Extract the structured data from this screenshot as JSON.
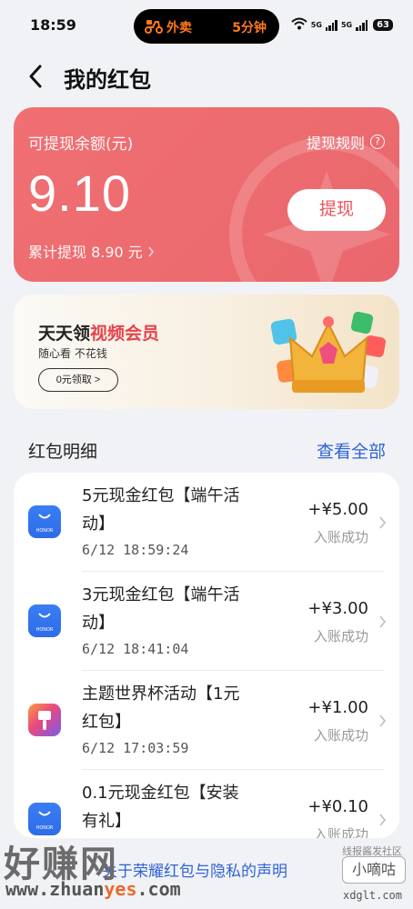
{
  "status_bar": {
    "time": "18:59",
    "island_text": "外卖",
    "island_eta": "5分钟",
    "signal_1": "5G",
    "signal_2": "5G",
    "battery": "63"
  },
  "header": {
    "title": "我的红包"
  },
  "balance": {
    "label": "可提现余额(元)",
    "rules_label": "提现规则",
    "amount": "9.10",
    "total_withdrawn": "累计提现 8.90 元",
    "withdraw_button": "提现"
  },
  "promo": {
    "title_plain": "天天领",
    "title_highlight": "视频会员",
    "subtitle": "随心看 不花钱",
    "button": "0元领取  >"
  },
  "section": {
    "title": "红包明细",
    "view_all": "查看全部"
  },
  "records": [
    {
      "name": "5元现金红包【端午活动】",
      "time": "6/12 18:59:24",
      "amount": "+¥5.00",
      "status": "入账成功",
      "icon": "honor-icon"
    },
    {
      "name": "3元现金红包【端午活动】",
      "time": "6/12 18:41:04",
      "amount": "+¥3.00",
      "status": "入账成功",
      "icon": "honor-icon"
    },
    {
      "name": "主题世界杯活动【1元红包】",
      "time": "6/12 17:03:59",
      "amount": "+¥1.00",
      "status": "入账成功",
      "icon": "theme-brush-icon"
    },
    {
      "name": "0.1元现金红包【安装有礼】",
      "time": "",
      "amount": "+¥0.10",
      "status": "入账成功",
      "icon": "honor-icon"
    }
  ],
  "footer": {
    "link": "关于荣耀红包与隐私的声明"
  },
  "watermark": {
    "logo": "好赚网",
    "url_prefix": "www.zhuan",
    "url_highlight": "yes",
    "url_suffix": ".com",
    "badge": "线报酱发社区",
    "tag": "小嘀咕",
    "right_url": "xdglt.com"
  },
  "colors": {
    "card_red": "#ec6b6f",
    "link_blue": "#2f63d8",
    "honor_blue": "#3a7df4",
    "island_orange": "#ff7a1a"
  }
}
